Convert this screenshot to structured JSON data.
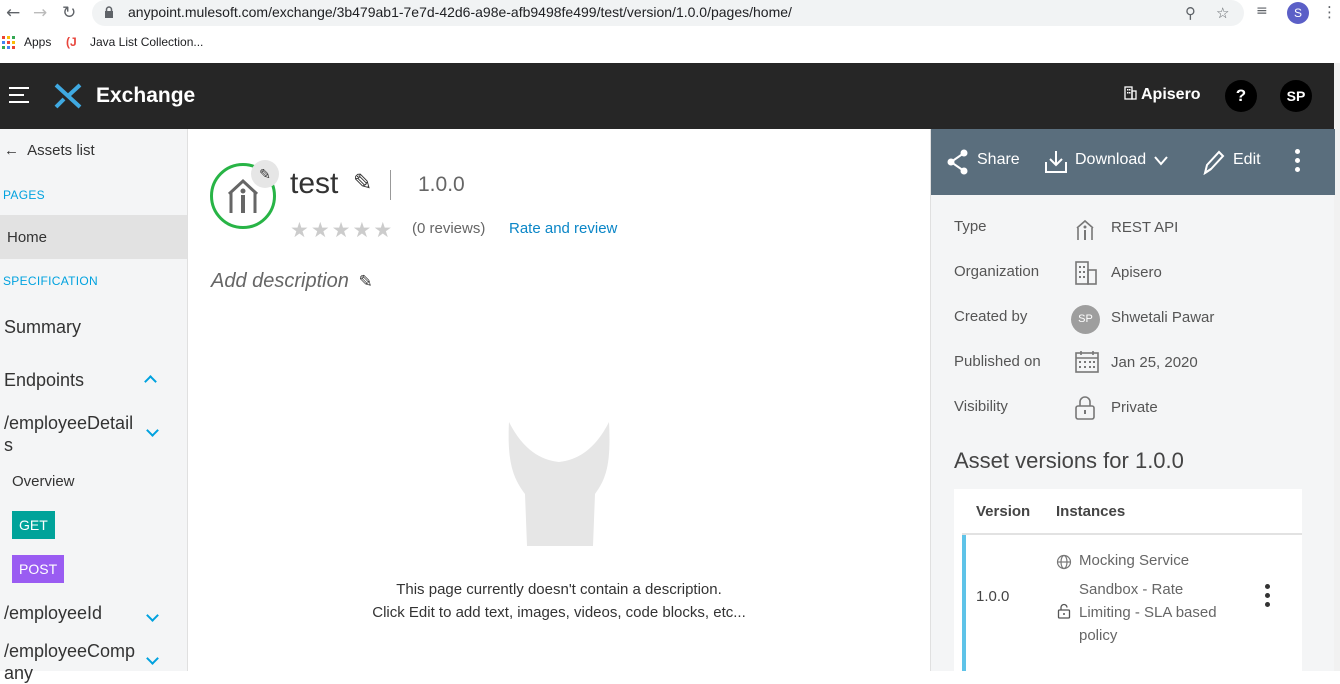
{
  "browser": {
    "url": "anypoint.mulesoft.com/exchange/3b479ab1-7e7d-42d6-a98e-afb9498fe499/test/version/1.0.0/pages/home/",
    "profile_initial": "S",
    "bookmarks": [
      {
        "label": "Apps"
      },
      {
        "label": "Java List Collection..."
      }
    ]
  },
  "header": {
    "app_title": "Exchange",
    "org_name": "Apisero",
    "help_label": "?",
    "user_initials": "SP"
  },
  "sidebar": {
    "back_label": "Assets list",
    "pages_section": "PAGES",
    "home_label": "Home",
    "spec_section": "SPECIFICATION",
    "summary_label": "Summary",
    "endpoints_label": "Endpoints",
    "endpoint1_line1": "/employeeDetail",
    "endpoint1_line2": "s",
    "overview_label": "Overview",
    "get_label": "GET",
    "post_label": "POST",
    "endpoint2": "/employeeId",
    "endpoint3_line1": "/employeeComp",
    "endpoint3_line2": "any"
  },
  "asset": {
    "name": "test",
    "version": "1.0.0",
    "reviews": "(0 reviews)",
    "rate_link": "Rate and review",
    "add_description": "Add description",
    "rating_stars": 0,
    "empty_line1": "This page currently doesn't contain a description.",
    "empty_line2": "Click Edit to add text, images, videos, code blocks, etc..."
  },
  "actions": {
    "share": "Share",
    "download": "Download",
    "edit": "Edit"
  },
  "meta": {
    "type_label": "Type",
    "type_value": "REST API",
    "org_label": "Organization",
    "org_value": "Apisero",
    "created_label": "Created by",
    "created_initials": "SP",
    "created_value": "Shwetali Pawar",
    "published_label": "Published on",
    "published_value": "Jan 25, 2020",
    "visibility_label": "Visibility",
    "visibility_value": "Private"
  },
  "versions": {
    "title": "Asset versions for 1.0.0",
    "col_version": "Version",
    "col_instances": "Instances",
    "rows": [
      {
        "version": "1.0.0",
        "instance1": "Mocking Service",
        "instance2_line1": "Sandbox - Rate",
        "instance2_line2": "Limiting - SLA based",
        "instance2_line3": "policy"
      }
    ]
  },
  "colors": {
    "header_bg": "#262626",
    "accent_blue": "#00a2df",
    "link_blue": "#0b86c7",
    "get_badge": "#00a39a",
    "post_badge": "#9a5cf2",
    "asset_ring": "#28b446",
    "action_bar": "#5a6e7d",
    "version_accent": "#5ec3e8"
  }
}
